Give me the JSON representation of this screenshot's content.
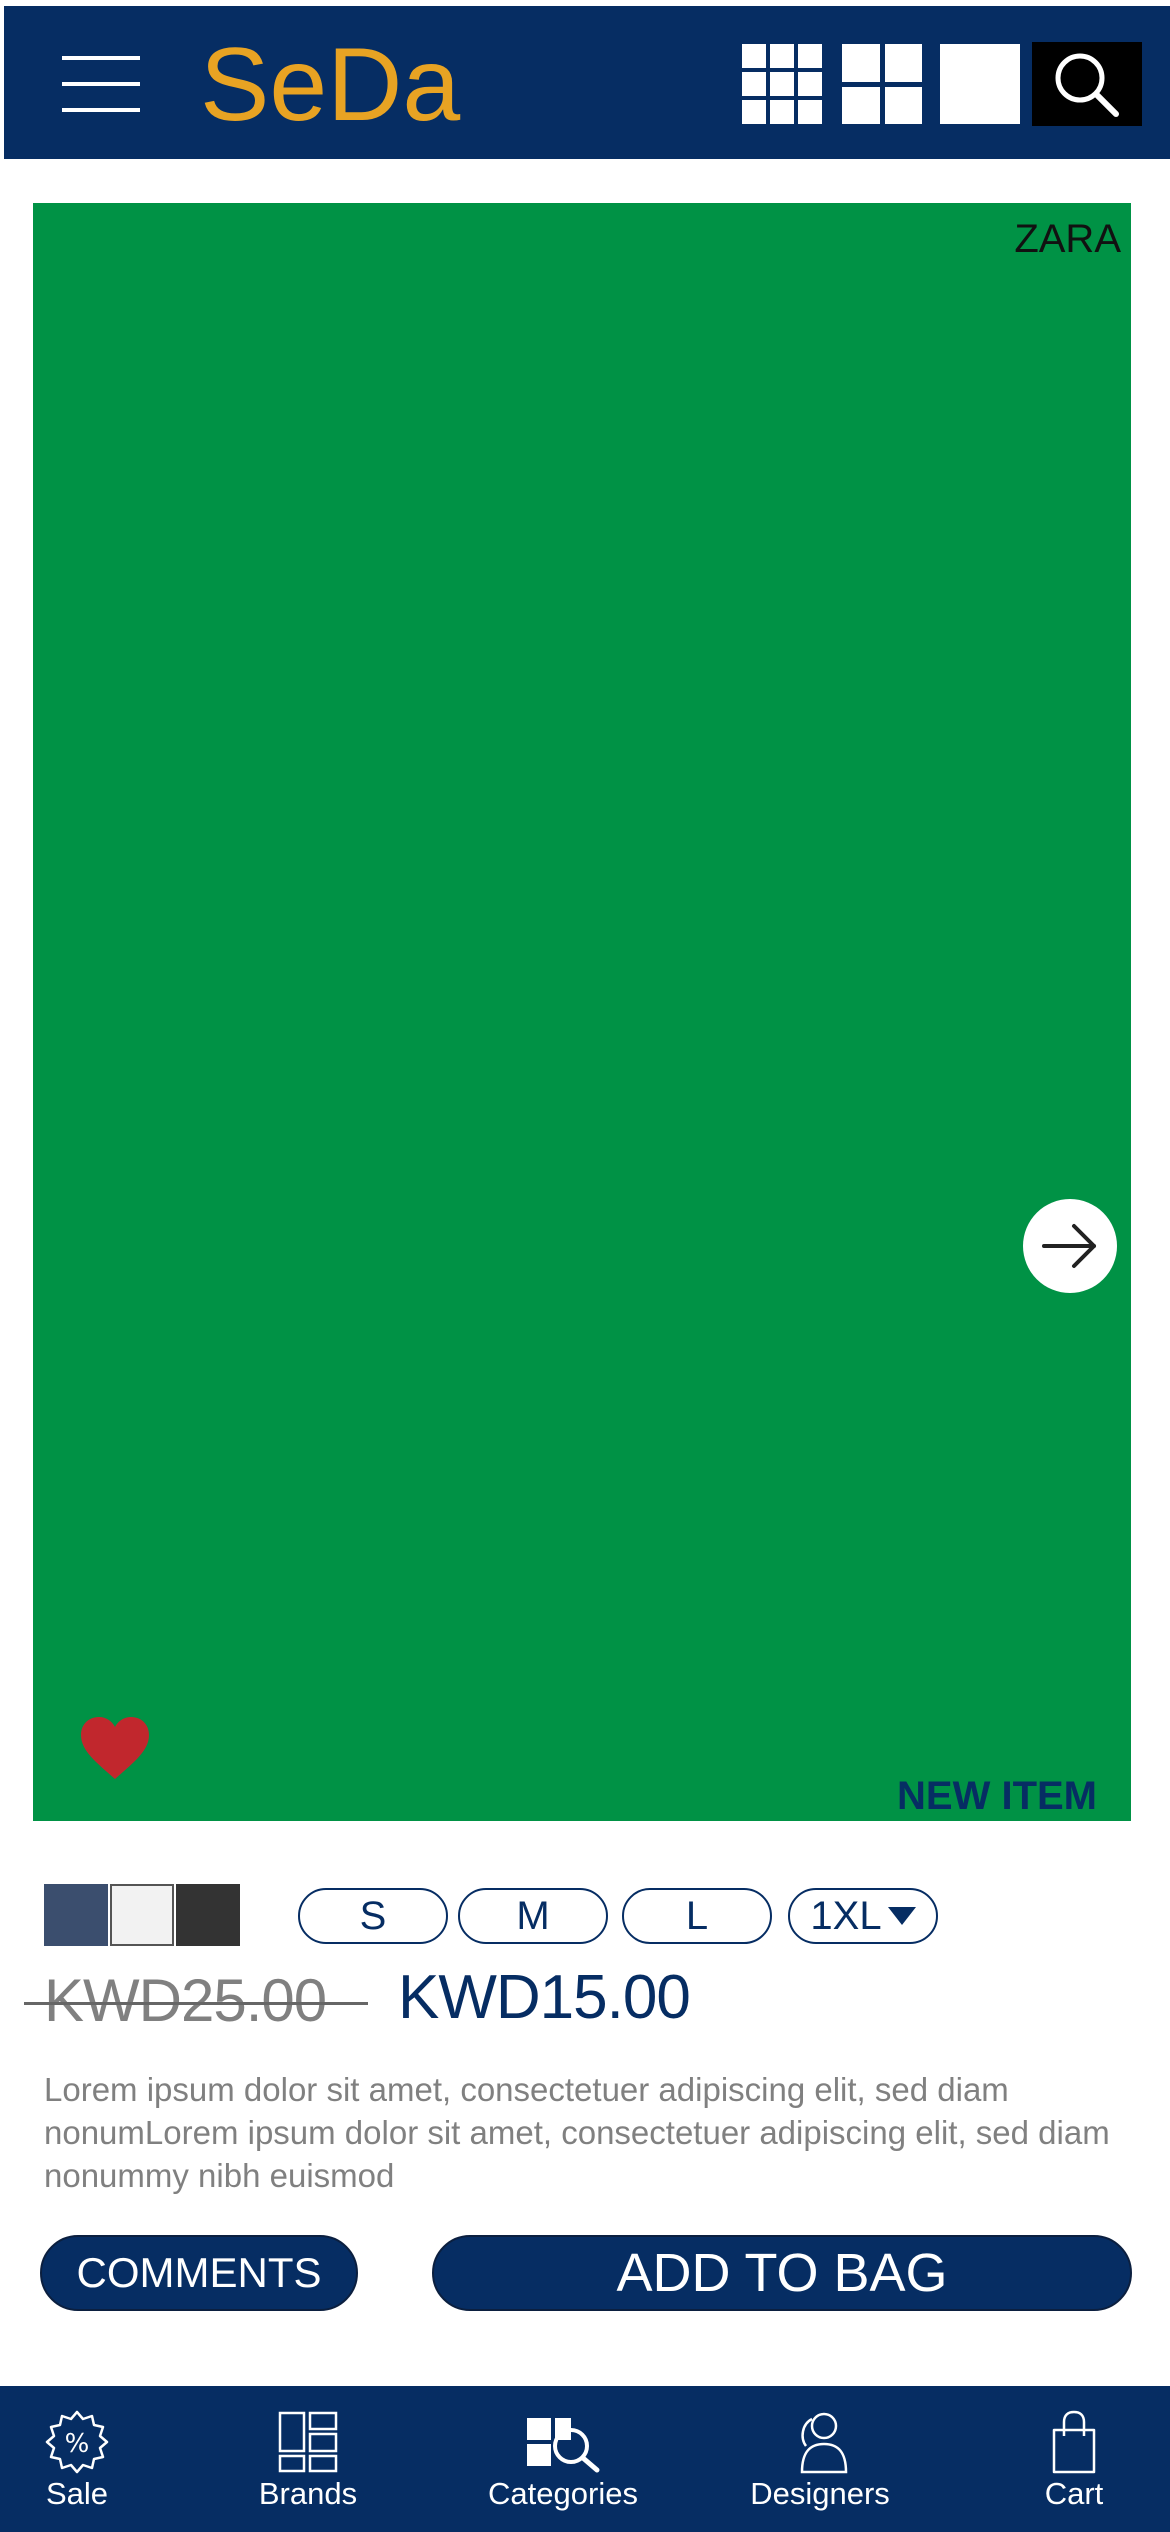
{
  "header": {
    "logo_text": "SeDa",
    "icons": [
      "menu-icon",
      "grid-3x3-icon",
      "grid-2x2-icon",
      "single-view-icon",
      "search-icon"
    ]
  },
  "product": {
    "brand": "ZARA",
    "badge": "NEW ITEM",
    "favorite_icon": "heart-icon",
    "next_icon": "arrow-right-icon",
    "colors": [
      "#3b4e6e",
      "#f2f2f2",
      "#333333"
    ],
    "sizes": [
      "S",
      "M",
      "L",
      "1XL"
    ],
    "old_price": "KWD25.00",
    "new_price": "KWD15.00",
    "description": "Lorem ipsum dolor sit amet, consectetuer adipiscing elit, sed diam nonumLorem ipsum dolor sit amet, consectetuer adipiscing elit, sed diam nonummy nibh euismod"
  },
  "actions": {
    "comments_label": "COMMENTS",
    "add_to_bag_label": "ADD TO BAG"
  },
  "nav": {
    "items": [
      {
        "label": "Sale",
        "icon": "sale-badge-icon"
      },
      {
        "label": "Brands",
        "icon": "brands-icon"
      },
      {
        "label": "Categories",
        "icon": "categories-icon"
      },
      {
        "label": "Designers",
        "icon": "designers-icon"
      },
      {
        "label": "Cart",
        "icon": "shopping-bag-icon"
      }
    ]
  },
  "colors": {
    "brand_navy": "#062d63",
    "logo_gold": "#e8a323",
    "image_green": "#009245",
    "heart_red": "#c1272d"
  }
}
